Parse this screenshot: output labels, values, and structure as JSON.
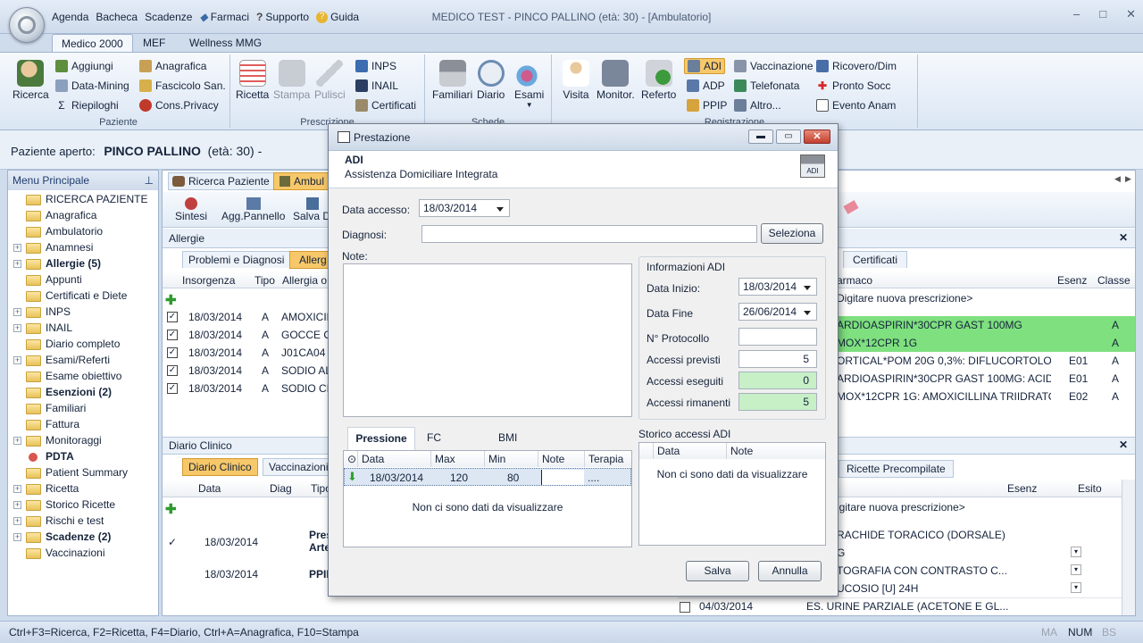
{
  "window": {
    "title": "MEDICO TEST - PINCO PALLINO (età: 30)   - [Ambulatorio]"
  },
  "quick": [
    "Agenda",
    "Bacheca",
    "Scadenze",
    "Farmaci",
    "Supporto",
    "Guida"
  ],
  "ribbon_tabs": [
    "Medico 2000",
    "MEF",
    "Wellness MMG"
  ],
  "ribbon": {
    "paziente": {
      "label": "Paziente",
      "ricerca": "Ricerca",
      "aggiungi": "Aggiungi",
      "datamining": "Data-Mining",
      "riepiloghi": "Riepiloghi",
      "anagrafica": "Anagrafica",
      "fascicolo": "Fascicolo San.",
      "consprivacy": "Cons.Privacy"
    },
    "prescrizione": {
      "label": "Prescrizione",
      "ricetta": "Ricetta",
      "stampa": "Stampa",
      "pulisci": "Pulisci",
      "inps": "INPS",
      "inail": "INAIL",
      "certificati": "Certificati"
    },
    "schede": {
      "label": "Schede",
      "familiari": "Familiari",
      "diario": "Diario",
      "esami": "Esami"
    },
    "registrazione": {
      "label": "Registrazione",
      "visita": "Visita",
      "monitor": "Monitor.",
      "referto": "Referto",
      "adi": "ADI",
      "adp": "ADP",
      "ppip": "PPIP",
      "vaccinazione": "Vaccinazione",
      "telefonata": "Telefonata",
      "altro": "Altro...",
      "ricovero": "Ricovero/Dim",
      "pronto": "Pronto Socc",
      "evento": "Evento Anam"
    }
  },
  "patient": {
    "label": "Paziente aperto:",
    "name": "PINCO PALLINO",
    "age": "(età: 30) -"
  },
  "sidebar": {
    "title": "Menu Principale",
    "items": [
      {
        "label": "RICERCA PAZIENTE",
        "bold": false,
        "exp": false
      },
      {
        "label": "Anagrafica",
        "bold": false,
        "exp": false
      },
      {
        "label": "Ambulatorio",
        "bold": false,
        "exp": false
      },
      {
        "label": "Anamnesi",
        "bold": false,
        "exp": true
      },
      {
        "label": "Allergie (5)",
        "bold": true,
        "exp": true
      },
      {
        "label": "Appunti",
        "bold": false,
        "exp": false
      },
      {
        "label": "Certificati e Diete",
        "bold": false,
        "exp": false
      },
      {
        "label": "INPS",
        "bold": false,
        "exp": true
      },
      {
        "label": "INAIL",
        "bold": false,
        "exp": true
      },
      {
        "label": "Diario completo",
        "bold": false,
        "exp": false
      },
      {
        "label": "Esami/Referti",
        "bold": false,
        "exp": true
      },
      {
        "label": "Esame obiettivo",
        "bold": false,
        "exp": false
      },
      {
        "label": "Esenzioni (2)",
        "bold": true,
        "exp": false
      },
      {
        "label": "Familiari",
        "bold": false,
        "exp": false
      },
      {
        "label": "Fattura",
        "bold": false,
        "exp": false
      },
      {
        "label": "Monitoraggi",
        "bold": false,
        "exp": true
      },
      {
        "label": "PDTA",
        "bold": true,
        "exp": false
      },
      {
        "label": "Patient Summary",
        "bold": false,
        "exp": false
      },
      {
        "label": "Ricetta",
        "bold": false,
        "exp": true
      },
      {
        "label": "Storico Ricette",
        "bold": false,
        "exp": true
      },
      {
        "label": "Rischi e test",
        "bold": false,
        "exp": true
      },
      {
        "label": "Scadenze (2)",
        "bold": true,
        "exp": true
      },
      {
        "label": "Vaccinazioni",
        "bold": false,
        "exp": false
      }
    ]
  },
  "main": {
    "tabs": [
      "Ricerca Paziente",
      "Ambul"
    ],
    "toolbar": [
      "Sintesi",
      "Agg.Pannello",
      "Salva Di"
    ],
    "allergie": {
      "title": "Allergie",
      "subtabs": [
        "Problemi e Diagnosi",
        "Allerg"
      ],
      "cols": [
        "Insorgenza",
        "Tipo",
        "Allergia o"
      ],
      "rows": [
        [
          "18/03/2014",
          "A",
          "AMOXICIL"
        ],
        [
          "18/03/2014",
          "A",
          "GOCCE O"
        ],
        [
          "18/03/2014",
          "A",
          "J01CA04"
        ],
        [
          "18/03/2014",
          "A",
          "SODIO AL"
        ],
        [
          "18/03/2014",
          "A",
          "SODIO CIT"
        ]
      ]
    },
    "diario": {
      "title": "Diario Clinico",
      "subtabs": [
        "Diario Clinico",
        "Vaccinazioni"
      ],
      "cols": [
        "Data",
        "Diag",
        "Tipo"
      ],
      "rows": [
        [
          "18/03/2014",
          "Pres Arte"
        ],
        [
          "18/03/2014",
          "PPIP"
        ]
      ]
    },
    "right": {
      "tab": "Certificati",
      "cols": [
        "armaco",
        "Esenz",
        "Classe"
      ],
      "newrow": "Digitare nuova prescrizione>",
      "rows": [
        [
          "ARDIOASPIRIN*30CPR GAST 100MG",
          "",
          "A",
          true
        ],
        [
          "MOX*12CPR 1G",
          "",
          "A",
          true
        ],
        [
          "ORTICAL*POM 20G 0,3%: DIFLUCORTOLON...",
          "E01",
          "A",
          false
        ],
        [
          "ARDIOASPIRIN*30CPR GAST 100MG: ACIDO...",
          "E01",
          "A",
          false
        ],
        [
          "MOX*12CPR 1G: AMOXICILLINA TRIIDRATO",
          "E02",
          "A",
          false
        ]
      ]
    },
    "right2": {
      "tab": "Ricette Precompilate",
      "cols": [
        "Esenz",
        "Esito"
      ],
      "newrow": "igitare nuova prescrizione>",
      "rows": [
        "RACHIDE TORACICO (DORSALE)",
        "G",
        "TOGRAFIA CON CONTRASTO C...",
        "UCOSIO [U] 24H"
      ],
      "last_date": "04/03/2014",
      "last_text": "ES. URINE PARZIALE (ACETONE E GL..."
    }
  },
  "dialog": {
    "title": "Prestazione",
    "code": "ADI",
    "subtitle": "Assistenza Domiciliare Integrata",
    "data_accesso_label": "Data accesso:",
    "data_accesso": "18/03/2014",
    "diagnosi_label": "Diagnosi:",
    "seleziona": "Seleziona",
    "note_label": "Note:",
    "info": {
      "title": "Informazioni ADI",
      "data_inizio_label": "Data Inizio:",
      "data_inizio": "18/03/2014",
      "data_fine_label": "Data Fine",
      "data_fine": "26/06/2014",
      "protocollo_label": "N° Protocollo",
      "previsti_label": "Accessi previsti",
      "previsti": "5",
      "eseguiti_label": "Accessi eseguiti",
      "eseguiti": "0",
      "rimanenti_label": "Accessi rimanenti",
      "rimanenti": "5"
    },
    "ptabs": [
      "Pressione",
      "FC",
      "BMI"
    ],
    "pcols": [
      "Data",
      "Max",
      "Min",
      "Note",
      "Terapia"
    ],
    "prow": {
      "data": "18/03/2014",
      "max": "120",
      "min": "80",
      "terapia": "...."
    },
    "empty": "Non ci sono dati da visualizzare",
    "storico": {
      "title": "Storico accessi ADI",
      "cols": [
        "Data",
        "Note"
      ],
      "empty": "Non ci sono dati da visualizzare"
    },
    "salva": "Salva",
    "annulla": "Annulla"
  },
  "status": {
    "text": "Ctrl+F3=Ricerca, F2=Ricetta, F4=Diario, Ctrl+A=Anagrafica, F10=Stampa",
    "ind": [
      "MA",
      "NUM",
      "BS"
    ]
  }
}
